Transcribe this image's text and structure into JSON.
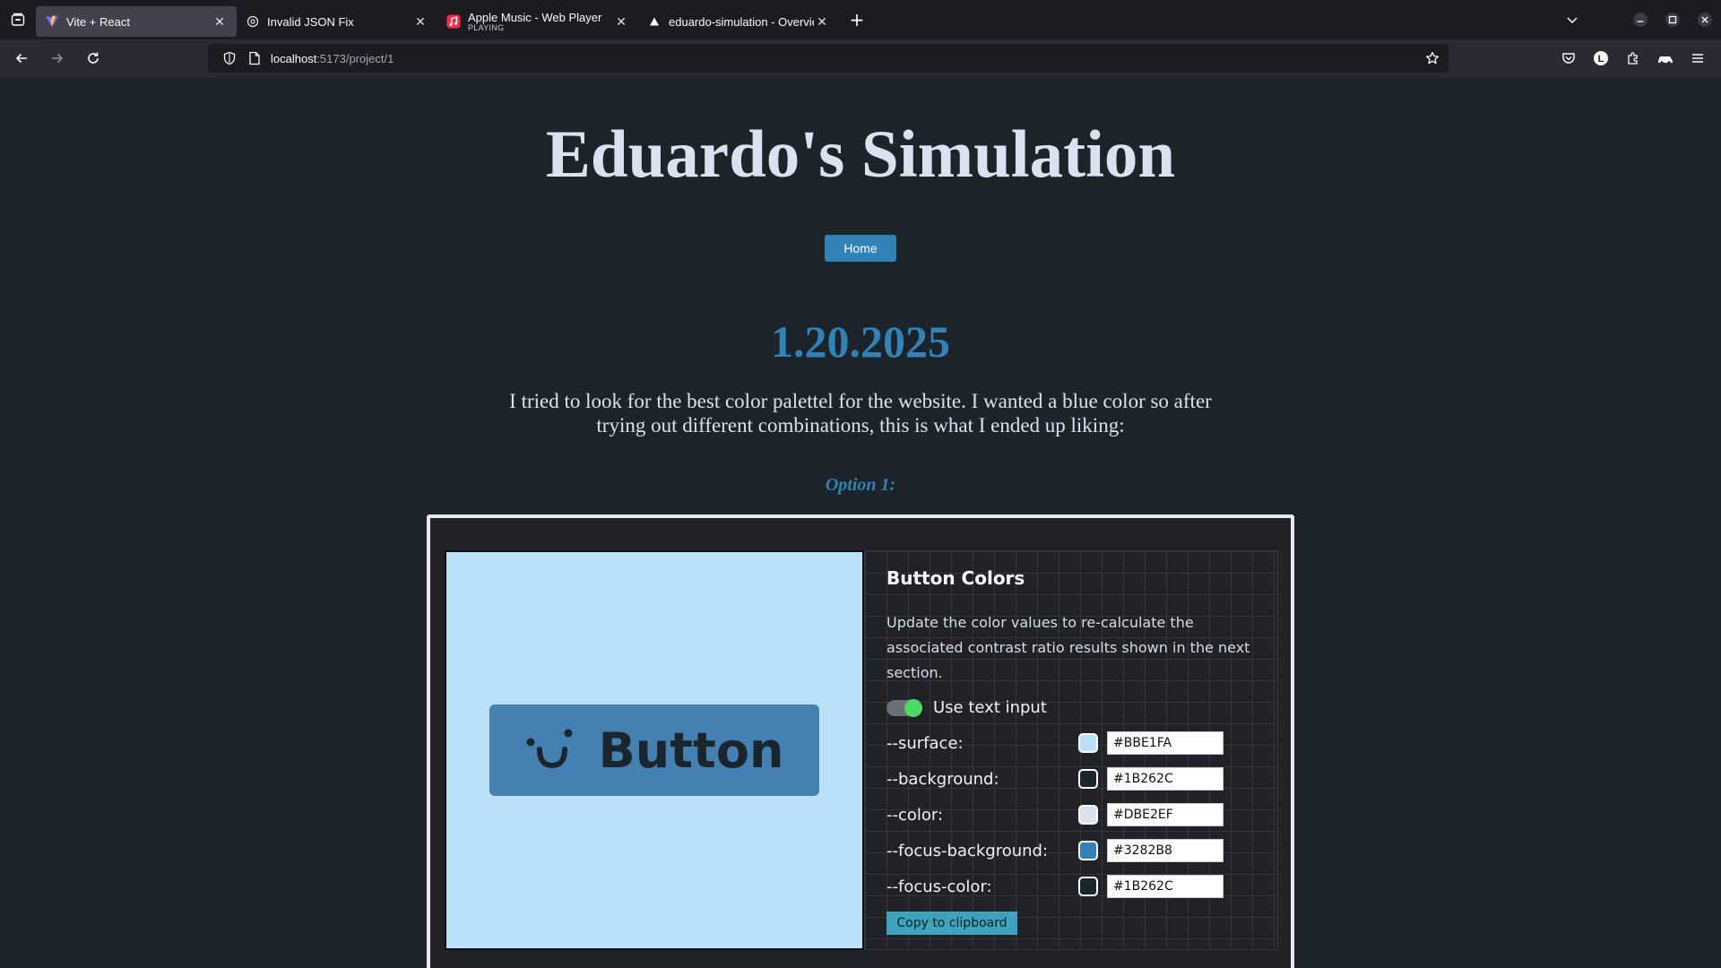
{
  "browser": {
    "tabs": [
      {
        "title": "Vite + React",
        "subtitle": "",
        "active": true,
        "icon": "vite-icon"
      },
      {
        "title": "Invalid JSON Fix",
        "subtitle": "",
        "active": false,
        "icon": "chatgpt-icon"
      },
      {
        "title": "Apple Music - Web Player",
        "subtitle": "PLAYING",
        "active": false,
        "icon": "apple-music-icon"
      },
      {
        "title": "eduardo-simulation - Overview -",
        "subtitle": "",
        "active": false,
        "icon": "vercel-icon"
      }
    ],
    "url_host": "localhost",
    "url_path": ":5173/project/1"
  },
  "page": {
    "title": "Eduardo's Simulation",
    "home_label": "Home",
    "date": "1.20.2025",
    "intro": "I tried to look for the best color palettel for the website. I wanted a blue color so after trying out different combinations, this is what I ended up liking:",
    "option_label": "Option 1:"
  },
  "demo": {
    "button_label": "Button",
    "panel_title": "Button Colors",
    "panel_desc": "Update the color values to re-calculate the associated contrast ratio results shown in the next section.",
    "toggle_label": "Use text input",
    "toggle_on": true,
    "colors": [
      {
        "name": "--surface:",
        "value": "#BBE1FA"
      },
      {
        "name": "--background:",
        "value": "#1B262C"
      },
      {
        "name": "--color:",
        "value": "#DBE2EF"
      },
      {
        "name": "--focus-background:",
        "value": "#3282B8"
      },
      {
        "name": "--focus-color:",
        "value": "#1B262C"
      }
    ],
    "copy_label": "Copy to clipboard"
  }
}
